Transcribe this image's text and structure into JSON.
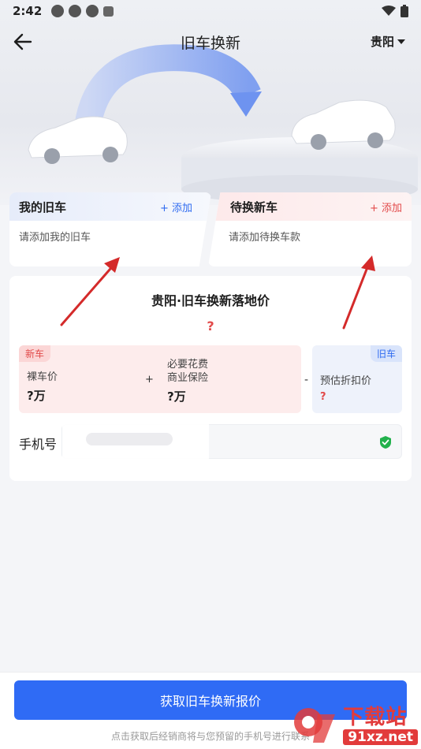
{
  "status_bar": {
    "time": "2:42"
  },
  "nav": {
    "title": "旧车换新",
    "city": "贵阳"
  },
  "cards": {
    "old": {
      "title": "我的旧车",
      "add": "+ 添加",
      "hint": "请添加我的旧车"
    },
    "new": {
      "title": "待换新车",
      "add": "+ 添加",
      "hint": "请添加待换车款"
    }
  },
  "panel": {
    "title": "贵阳·旧车换新落地价",
    "total": "?",
    "new_tag": "新车",
    "bare_label": "裸车价",
    "bare_value": "?万",
    "plus": "+",
    "fees_label_1": "必要花费",
    "fees_label_2": "商业保险",
    "fees_value": "?万",
    "minus": "-",
    "old_tag": "旧车",
    "discount_label": "预估折扣价",
    "discount_value": "?",
    "phone_label": "手机号"
  },
  "footer": {
    "cta": "获取旧车换新报价",
    "note": "点击获取后经销商将与您预留的手机号进行联系"
  },
  "watermark": {
    "cn": "下载站",
    "en": "91xz.net"
  },
  "colors": {
    "accent_blue": "#2f6bf5",
    "accent_red": "#e24a4a",
    "arrow_red": "#d42a2a"
  }
}
